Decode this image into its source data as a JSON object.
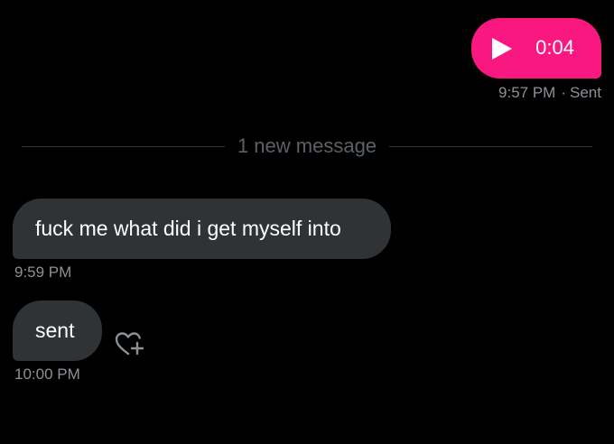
{
  "colors": {
    "background": "#000000",
    "outgoing_bubble": "#f91880",
    "incoming_bubble": "#2f3336",
    "meta_text": "#8b9196",
    "divider_text": "#5b6166"
  },
  "outgoing": {
    "voice_message": {
      "play_icon": "play-icon",
      "duration": "0:04"
    },
    "time": "9:57 PM",
    "separator": "·",
    "status": "Sent"
  },
  "divider": {
    "label": "1 new message"
  },
  "incoming": [
    {
      "text": "fuck me what did i get myself into",
      "time": "9:59 PM"
    },
    {
      "text": "sent",
      "time": "10:00 PM",
      "reaction_icon": "heart-plus-icon"
    }
  ]
}
